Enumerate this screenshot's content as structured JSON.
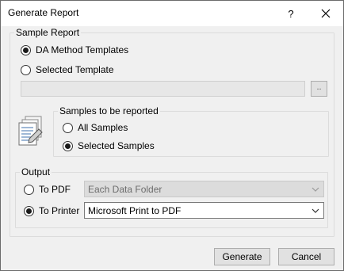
{
  "window": {
    "title": "Generate Report",
    "help_glyph": "?"
  },
  "sample_report": {
    "label": "Sample Report",
    "option_da": "DA Method Templates",
    "option_selected": "Selected Template",
    "template_path": "",
    "browse_label": "..",
    "da_checked": true
  },
  "samples": {
    "label": "Samples to be reported",
    "option_all": "All Samples",
    "option_selected": "Selected Samples",
    "selected_checked": true
  },
  "output": {
    "label": "Output",
    "to_pdf": "To PDF",
    "pdf_folder": "Each Data Folder",
    "to_printer": "To Printer",
    "printer_name": "Microsoft Print to PDF",
    "printer_checked": true
  },
  "buttons": {
    "generate": "Generate",
    "cancel": "Cancel"
  },
  "icons": {
    "close": "close-icon",
    "document": "document-icon",
    "dropdown": "chevron-down-icon"
  }
}
